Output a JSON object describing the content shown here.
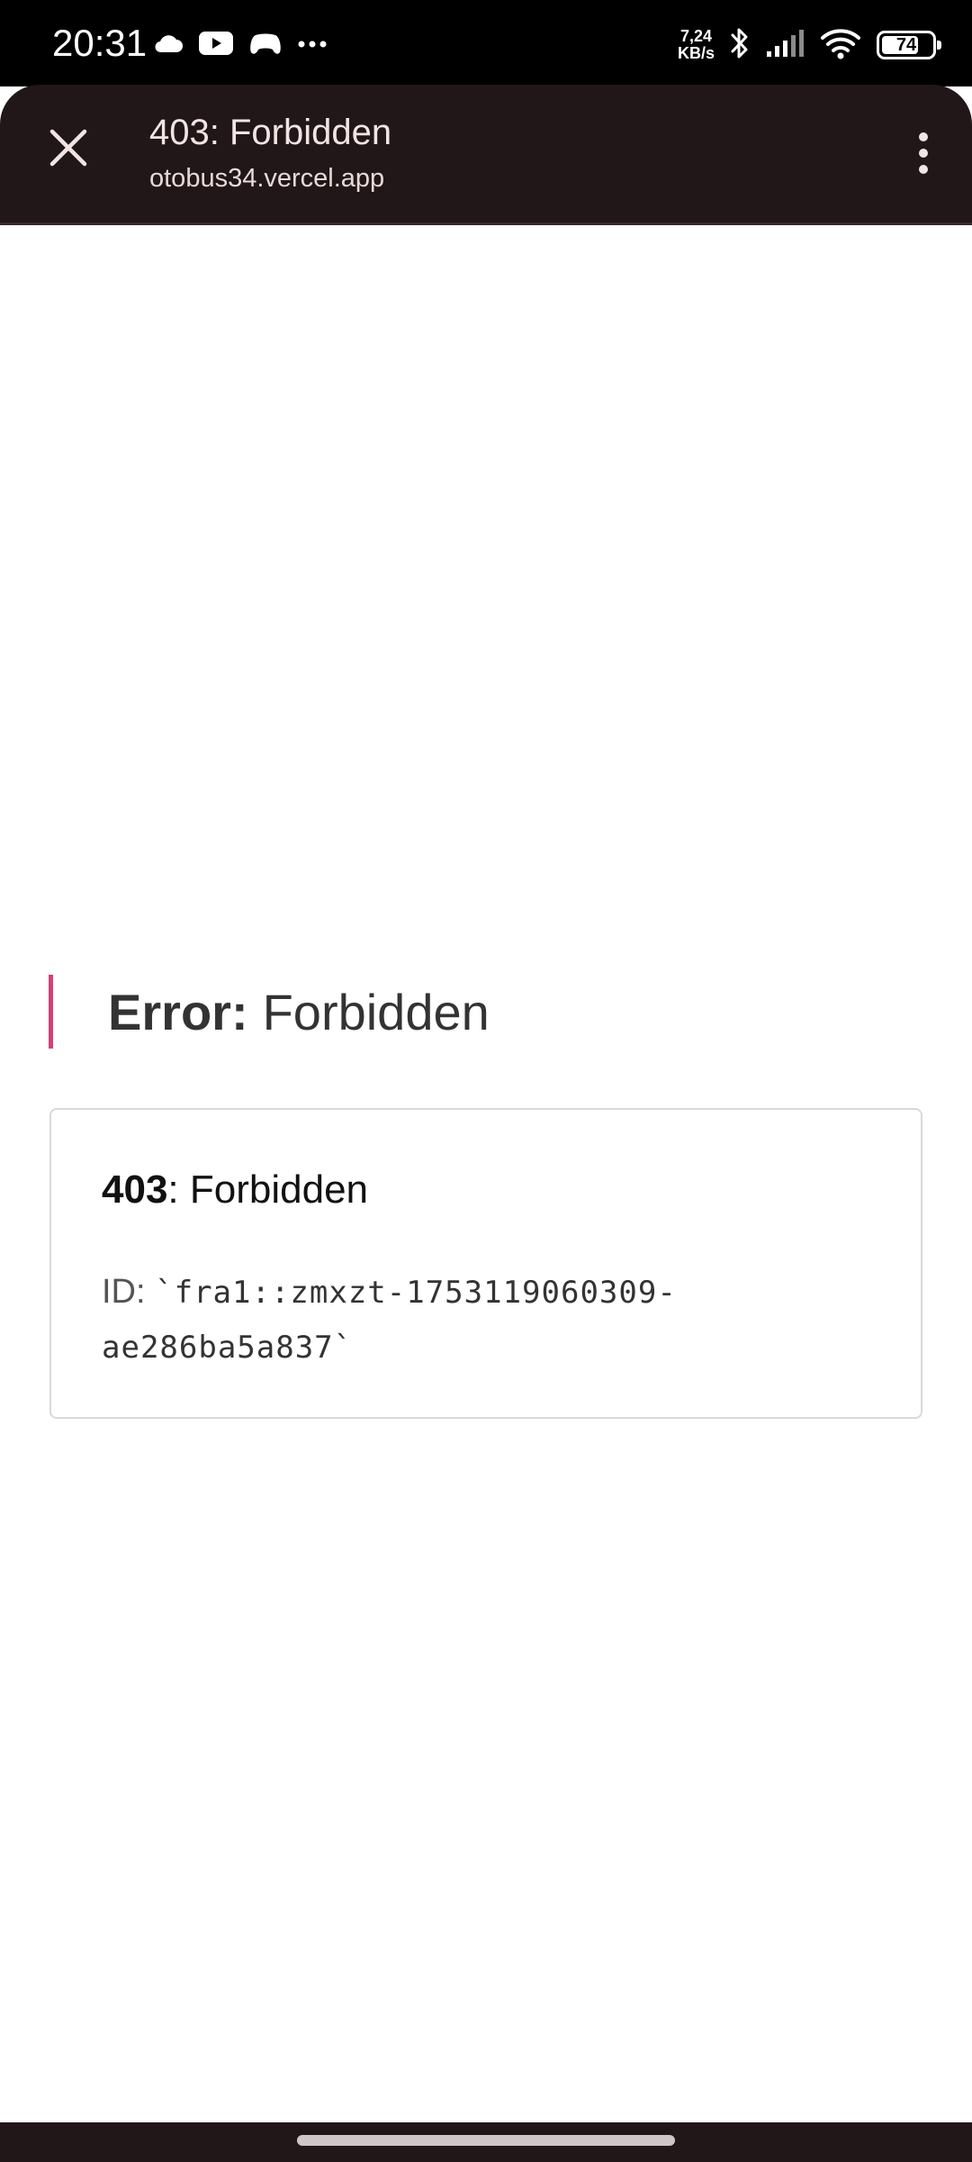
{
  "status_bar": {
    "time": "20:31",
    "net_speed_value": "7,24",
    "net_speed_unit": "KB/s",
    "battery_level": "74",
    "battery_fraction": 0.74,
    "left_icons": [
      "cloud-icon",
      "youtube-icon",
      "game-controller-icon",
      "more-notifications-icon"
    ],
    "right_icons": [
      "bluetooth-icon",
      "signal-icon",
      "wifi-icon",
      "battery-icon"
    ]
  },
  "toolbar": {
    "title": "403: Forbidden",
    "url": "otobus34.vercel.app",
    "close_icon": "close-icon",
    "menu_icon": "more-vert-icon",
    "background_color": "#221718"
  },
  "page": {
    "error_label": "Error:",
    "error_text": "Forbidden",
    "accent_color": "#d0427a",
    "card": {
      "code": "403",
      "separator": ":",
      "message": "Forbidden",
      "id_label": "ID:",
      "id_value": "`fra1::zmxzt-1753119060309-ae286ba5a837`"
    }
  }
}
